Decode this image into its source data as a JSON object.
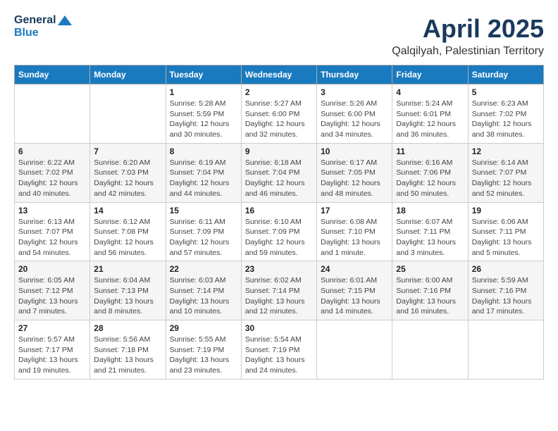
{
  "header": {
    "logo_line1": "General",
    "logo_line2": "Blue",
    "month": "April 2025",
    "location": "Qalqilyah, Palestinian Territory"
  },
  "weekdays": [
    "Sunday",
    "Monday",
    "Tuesday",
    "Wednesday",
    "Thursday",
    "Friday",
    "Saturday"
  ],
  "weeks": [
    [
      {
        "day": "",
        "info": ""
      },
      {
        "day": "",
        "info": ""
      },
      {
        "day": "1",
        "info": "Sunrise: 5:28 AM\nSunset: 5:59 PM\nDaylight: 12 hours\nand 30 minutes."
      },
      {
        "day": "2",
        "info": "Sunrise: 5:27 AM\nSunset: 6:00 PM\nDaylight: 12 hours\nand 32 minutes."
      },
      {
        "day": "3",
        "info": "Sunrise: 5:26 AM\nSunset: 6:00 PM\nDaylight: 12 hours\nand 34 minutes."
      },
      {
        "day": "4",
        "info": "Sunrise: 5:24 AM\nSunset: 6:01 PM\nDaylight: 12 hours\nand 36 minutes."
      },
      {
        "day": "5",
        "info": "Sunrise: 6:23 AM\nSunset: 7:02 PM\nDaylight: 12 hours\nand 38 minutes."
      }
    ],
    [
      {
        "day": "6",
        "info": "Sunrise: 6:22 AM\nSunset: 7:02 PM\nDaylight: 12 hours\nand 40 minutes."
      },
      {
        "day": "7",
        "info": "Sunrise: 6:20 AM\nSunset: 7:03 PM\nDaylight: 12 hours\nand 42 minutes."
      },
      {
        "day": "8",
        "info": "Sunrise: 6:19 AM\nSunset: 7:04 PM\nDaylight: 12 hours\nand 44 minutes."
      },
      {
        "day": "9",
        "info": "Sunrise: 6:18 AM\nSunset: 7:04 PM\nDaylight: 12 hours\nand 46 minutes."
      },
      {
        "day": "10",
        "info": "Sunrise: 6:17 AM\nSunset: 7:05 PM\nDaylight: 12 hours\nand 48 minutes."
      },
      {
        "day": "11",
        "info": "Sunrise: 6:16 AM\nSunset: 7:06 PM\nDaylight: 12 hours\nand 50 minutes."
      },
      {
        "day": "12",
        "info": "Sunrise: 6:14 AM\nSunset: 7:07 PM\nDaylight: 12 hours\nand 52 minutes."
      }
    ],
    [
      {
        "day": "13",
        "info": "Sunrise: 6:13 AM\nSunset: 7:07 PM\nDaylight: 12 hours\nand 54 minutes."
      },
      {
        "day": "14",
        "info": "Sunrise: 6:12 AM\nSunset: 7:08 PM\nDaylight: 12 hours\nand 56 minutes."
      },
      {
        "day": "15",
        "info": "Sunrise: 6:11 AM\nSunset: 7:09 PM\nDaylight: 12 hours\nand 57 minutes."
      },
      {
        "day": "16",
        "info": "Sunrise: 6:10 AM\nSunset: 7:09 PM\nDaylight: 12 hours\nand 59 minutes."
      },
      {
        "day": "17",
        "info": "Sunrise: 6:08 AM\nSunset: 7:10 PM\nDaylight: 13 hours\nand 1 minute."
      },
      {
        "day": "18",
        "info": "Sunrise: 6:07 AM\nSunset: 7:11 PM\nDaylight: 13 hours\nand 3 minutes."
      },
      {
        "day": "19",
        "info": "Sunrise: 6:06 AM\nSunset: 7:11 PM\nDaylight: 13 hours\nand 5 minutes."
      }
    ],
    [
      {
        "day": "20",
        "info": "Sunrise: 6:05 AM\nSunset: 7:12 PM\nDaylight: 13 hours\nand 7 minutes."
      },
      {
        "day": "21",
        "info": "Sunrise: 6:04 AM\nSunset: 7:13 PM\nDaylight: 13 hours\nand 8 minutes."
      },
      {
        "day": "22",
        "info": "Sunrise: 6:03 AM\nSunset: 7:14 PM\nDaylight: 13 hours\nand 10 minutes."
      },
      {
        "day": "23",
        "info": "Sunrise: 6:02 AM\nSunset: 7:14 PM\nDaylight: 13 hours\nand 12 minutes."
      },
      {
        "day": "24",
        "info": "Sunrise: 6:01 AM\nSunset: 7:15 PM\nDaylight: 13 hours\nand 14 minutes."
      },
      {
        "day": "25",
        "info": "Sunrise: 6:00 AM\nSunset: 7:16 PM\nDaylight: 13 hours\nand 16 minutes."
      },
      {
        "day": "26",
        "info": "Sunrise: 5:59 AM\nSunset: 7:16 PM\nDaylight: 13 hours\nand 17 minutes."
      }
    ],
    [
      {
        "day": "27",
        "info": "Sunrise: 5:57 AM\nSunset: 7:17 PM\nDaylight: 13 hours\nand 19 minutes."
      },
      {
        "day": "28",
        "info": "Sunrise: 5:56 AM\nSunset: 7:18 PM\nDaylight: 13 hours\nand 21 minutes."
      },
      {
        "day": "29",
        "info": "Sunrise: 5:55 AM\nSunset: 7:19 PM\nDaylight: 13 hours\nand 23 minutes."
      },
      {
        "day": "30",
        "info": "Sunrise: 5:54 AM\nSunset: 7:19 PM\nDaylight: 13 hours\nand 24 minutes."
      },
      {
        "day": "",
        "info": ""
      },
      {
        "day": "",
        "info": ""
      },
      {
        "day": "",
        "info": ""
      }
    ]
  ]
}
